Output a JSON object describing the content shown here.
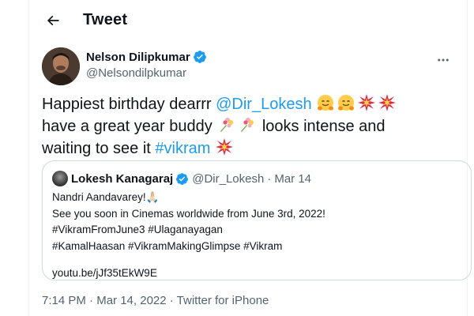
{
  "header": {
    "title": "Tweet"
  },
  "author": {
    "name": "Nelson Dilipkumar",
    "handle": "@Nelsondilpkumar"
  },
  "tweet": {
    "text_1": "Happiest birthday dearrr ",
    "mention": "@Dir_Lokesh",
    "text_2": "have a great year buddy ",
    "text_3": " looks intense and",
    "text_4": "waiting to see it ",
    "hashtag": "#vikram",
    "emoji_names": [
      "hugging-face",
      "collision",
      "bouquet"
    ]
  },
  "quote": {
    "author_name": "Lokesh Kanagaraj",
    "author_handle": "@Dir_Lokesh",
    "separator": "·",
    "date": "Mar 14",
    "lines": [
      "Nandri Aandavarey!🙏🏻",
      "See you soon in Cinemas worldwide from June 3rd, 2022!",
      "#VikramFromJune3 #Ulaganayagan",
      "#KamalHaasan #VikramMakingGlimpse #Vikram",
      "youtu.be/jJf35tEkW9E"
    ]
  },
  "meta": {
    "time": "7:14 PM",
    "separator": " · ",
    "date": "Mar 14, 2022",
    "source": "Twitter for iPhone"
  },
  "colors": {
    "link": "#1d9bf0",
    "text": "#0f1419",
    "secondary": "#536471",
    "border": "#cfd9de"
  }
}
